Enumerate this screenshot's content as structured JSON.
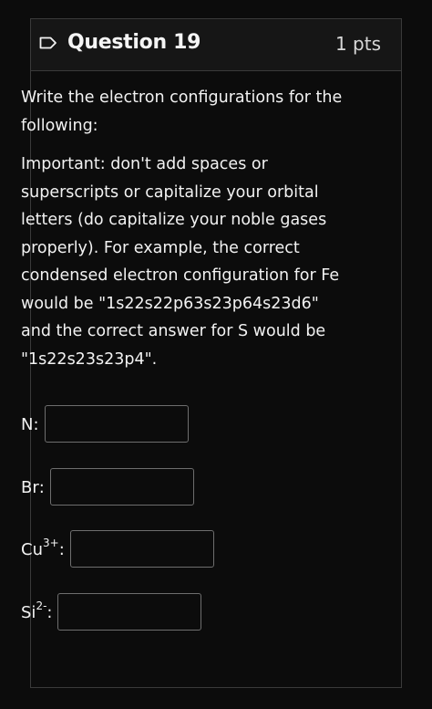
{
  "question": {
    "title": "Question 19",
    "points": "1 pts",
    "prompt": "Write the electron configurations for the following:",
    "instructions": "Important: don't add spaces or superscripts or capitalize your orbital letters (do capitalize your noble gases properly). For example, the correct condensed electron configuration for Fe would be \"1s22s22p63s23p64s23d6\" and the correct answer for S would be \"1s22s23s23p4\".",
    "answers": [
      {
        "label": "N",
        "superscript": "",
        "suffix": ":",
        "value": ""
      },
      {
        "label": "Br",
        "superscript": "",
        "suffix": ":",
        "value": ""
      },
      {
        "label": "Cu",
        "superscript": "3+",
        "suffix": ":",
        "value": ""
      },
      {
        "label": "Si",
        "superscript": "2-",
        "suffix": ":",
        "value": ""
      }
    ]
  },
  "colors": {
    "background": "#0c0c0c",
    "header_background": "#161616",
    "border": "#3a3a3a",
    "input_border": "#6e6e6e",
    "text": "#f2f2f2"
  },
  "icons": {
    "flag": "bookmark-flag-icon"
  }
}
